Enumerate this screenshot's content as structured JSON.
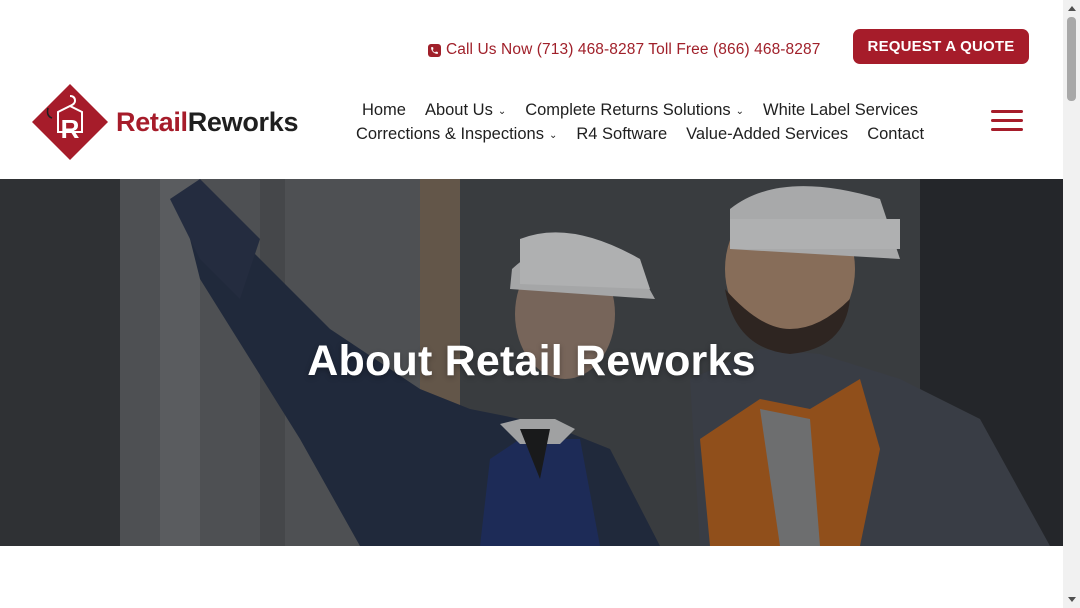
{
  "header": {
    "phone_text": "Call Us Now (713) 468-8287 Toll Free (866) 468-8287",
    "quote_button": "REQUEST A QUOTE",
    "logo": {
      "part1": "Retail",
      "part2": "Reworks"
    }
  },
  "nav": {
    "row1": [
      {
        "label": "Home",
        "dropdown": false
      },
      {
        "label": "About Us",
        "dropdown": true
      },
      {
        "label": "Complete Returns Solutions",
        "dropdown": true
      },
      {
        "label": "White Label Services",
        "dropdown": false
      }
    ],
    "row2": [
      {
        "label": "Corrections & Inspections",
        "dropdown": true
      },
      {
        "label": "R4 Software",
        "dropdown": false
      },
      {
        "label": "Value-Added Services",
        "dropdown": false
      },
      {
        "label": "Contact",
        "dropdown": false
      }
    ],
    "dropdown_glyph": "⌄"
  },
  "hero": {
    "title": "About Retail Reworks"
  },
  "colors": {
    "brand_red": "#a61c2a",
    "text_dark": "#1f1f1f"
  },
  "icons": {
    "phone": "phone-icon",
    "menu": "hamburger-menu-icon",
    "scroll_up": "scroll-up-arrow-icon",
    "scroll_down": "scroll-down-arrow-icon"
  }
}
